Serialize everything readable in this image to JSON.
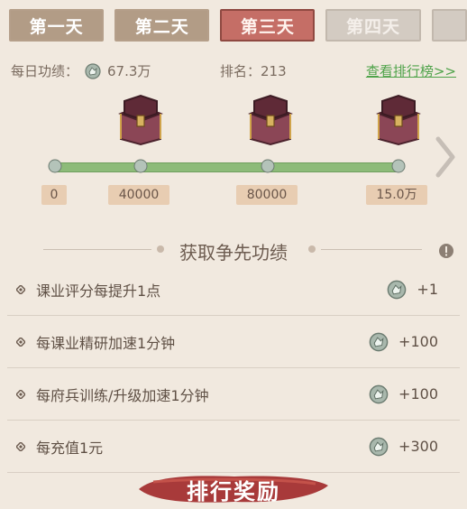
{
  "tabs": [
    {
      "label": "第一天",
      "state": "normal"
    },
    {
      "label": "第二天",
      "state": "normal"
    },
    {
      "label": "第三天",
      "state": "active"
    },
    {
      "label": "第四天",
      "state": "disabled"
    }
  ],
  "stats": {
    "daily_label": "每日功绩：",
    "daily_value": "67.3万",
    "rank_label": "排名：213",
    "ranking_link": "查看排行榜>>"
  },
  "progress": {
    "milestones": [
      "0",
      "40000",
      "80000",
      "15.0万"
    ]
  },
  "section": {
    "title": "获取争先功绩"
  },
  "tasks": [
    {
      "label": "课业评分每提升1点",
      "reward": "+1"
    },
    {
      "label": "每课业精研加速1分钟",
      "reward": "+100"
    },
    {
      "label": "每府兵训练/升级加速1分钟",
      "reward": "+100"
    },
    {
      "label": "每充值1元",
      "reward": "+300"
    }
  ],
  "banner": {
    "label": "排行奖励"
  },
  "colors": {
    "active_tab": "#c56e66",
    "progress_fill": "#8dbb79",
    "link": "#4fa34a",
    "banner": "#a83a3a"
  }
}
